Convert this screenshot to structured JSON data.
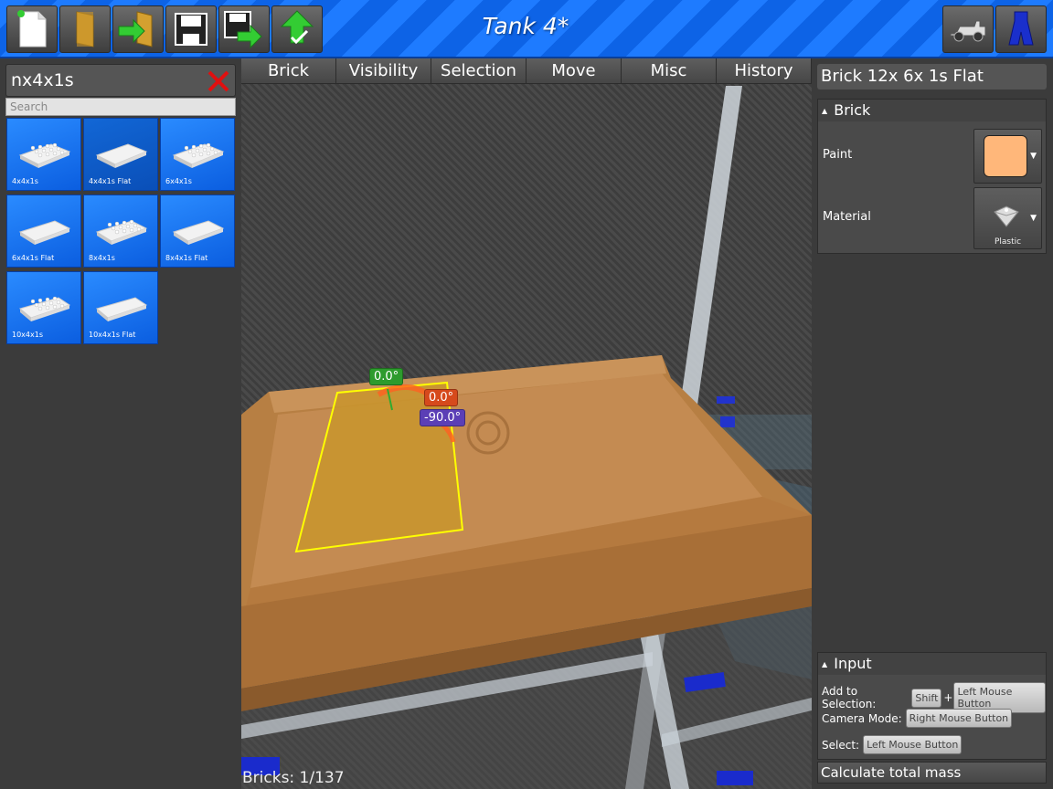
{
  "app": {
    "title": "Tank 4*"
  },
  "toolbar": {
    "buttons": [
      {
        "name": "new-file-button",
        "icon": "new-file-icon"
      },
      {
        "name": "open-folder-button",
        "icon": "folder-icon"
      },
      {
        "name": "import-button",
        "icon": "import-icon"
      },
      {
        "name": "save-button",
        "icon": "save-icon"
      },
      {
        "name": "save-as-button",
        "icon": "save-as-icon"
      },
      {
        "name": "upload-button",
        "icon": "upload-icon"
      }
    ],
    "right_buttons": [
      {
        "name": "vehicle-mode-button",
        "icon": "jeep-icon"
      },
      {
        "name": "character-mode-button",
        "icon": "minifig-icon"
      }
    ]
  },
  "left": {
    "filter_text": "nx4x1s",
    "search_placeholder": "Search",
    "bricks": [
      {
        "label": "4x4x1s",
        "studs": true,
        "selected": false
      },
      {
        "label": "4x4x1s Flat",
        "studs": false,
        "selected": true
      },
      {
        "label": "6x4x1s",
        "studs": true,
        "selected": false
      },
      {
        "label": "6x4x1s Flat",
        "studs": false,
        "selected": false
      },
      {
        "label": "8x4x1s",
        "studs": true,
        "selected": false
      },
      {
        "label": "8x4x1s Flat",
        "studs": false,
        "selected": false
      },
      {
        "label": "10x4x1s",
        "studs": true,
        "selected": false
      },
      {
        "label": "10x4x1s Flat",
        "studs": false,
        "selected": false
      }
    ]
  },
  "viewport": {
    "menu": [
      "Brick",
      "Visibility",
      "Selection",
      "Move",
      "Misc",
      "History"
    ],
    "rotations": {
      "green": "0.0°",
      "red": "0.0°",
      "blue": "-90.0°"
    },
    "status": "Bricks: 1/137"
  },
  "right": {
    "brick_name": "Brick 12x 6x 1s Flat",
    "brick_section": {
      "title": "Brick",
      "paint_label": "Paint",
      "paint_color": "#ffb77a",
      "material_label": "Material",
      "material_value": "Plastic"
    },
    "input_section": {
      "title": "Input",
      "add_selection_label": "Add to Selection:",
      "shift_key": "Shift",
      "plus": "+",
      "left_mouse": "Left Mouse Button",
      "camera_mode_label": "Camera Mode:",
      "right_mouse": "Right Mouse Button",
      "select_label": "Select:",
      "select_key": "Left Mouse Button"
    },
    "calc_mass": "Calculate total mass"
  },
  "colors": {
    "accent_blue": "#1e7bff",
    "brick_orange": "#c88a4a",
    "selection_yellow": "#ffff00"
  }
}
